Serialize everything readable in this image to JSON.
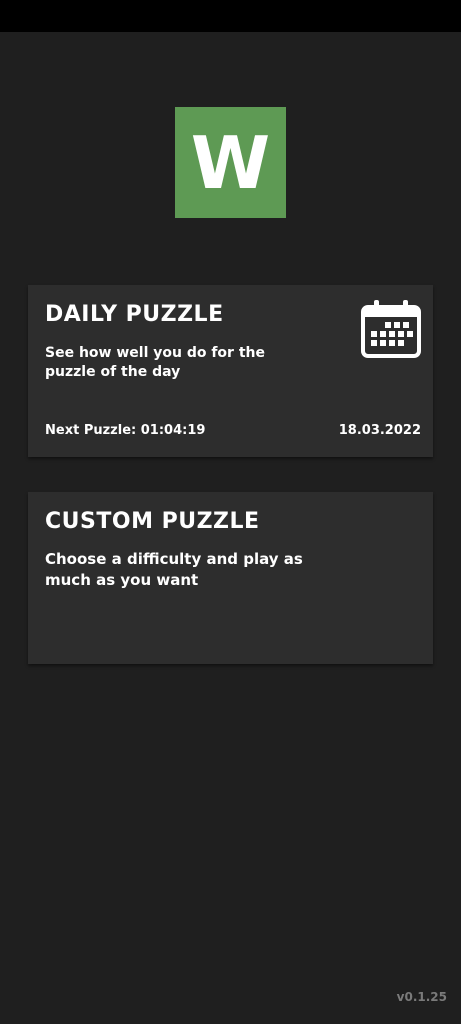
{
  "logo": {
    "letter": "W",
    "color": "#5e9a54"
  },
  "daily": {
    "title": "DAILY PUZZLE",
    "description": "See how well you do for the puzzle of the day",
    "next_puzzle": "Next Puzzle: 01:04:19",
    "date": "18.03.2022",
    "icon": "calendar-icon"
  },
  "custom": {
    "title": "CUSTOM PUZZLE",
    "description": "Choose a difficulty and play as much as you want"
  },
  "version": "v0.1.25"
}
